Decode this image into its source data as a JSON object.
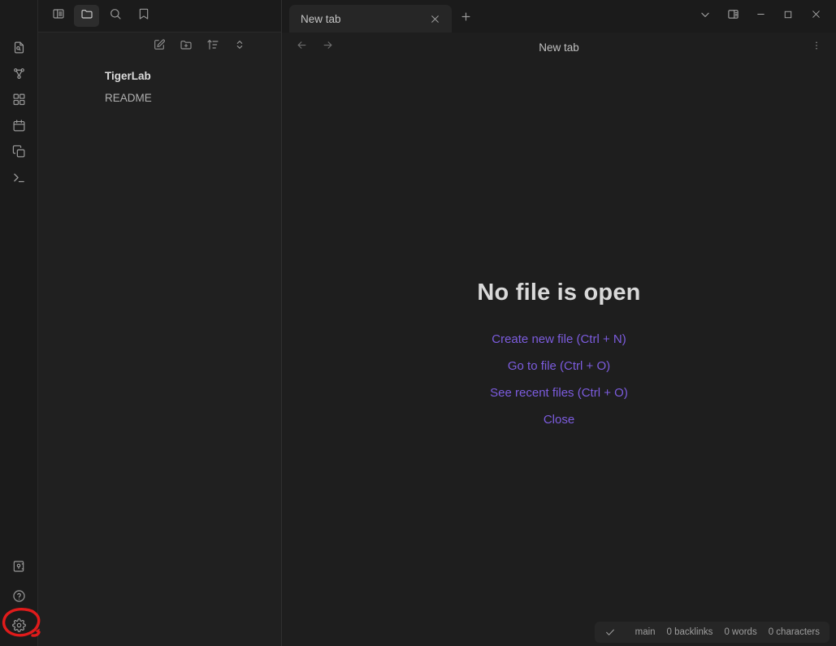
{
  "app": {
    "window_title": "New tab",
    "theme": "dark"
  },
  "colors": {
    "background": "#1e1e1e",
    "ribbon_background": "#1b1b1b",
    "sidebar_background": "#202020",
    "tab_active_background": "#262626",
    "link_accent": "#7c5cde",
    "text_normal": "#c4c4c4",
    "text_muted": "#9a9a9a",
    "annotation_red": "#e01b1b"
  },
  "ribbon": {
    "top_items": [
      {
        "name": "toggle-left-sidebar",
        "icon": "sidebar-toggle-icon",
        "label": "Toggle left sidebar"
      },
      {
        "name": "files",
        "icon": "folder-icon",
        "label": "Files",
        "active": true
      },
      {
        "name": "search",
        "icon": "search-icon",
        "label": "Search"
      },
      {
        "name": "bookmarks",
        "icon": "bookmark-icon",
        "label": "Bookmarks"
      }
    ],
    "items": [
      {
        "name": "quick-switcher",
        "icon": "file-search-icon",
        "label": "Quick switcher"
      },
      {
        "name": "graph-view",
        "icon": "graph-icon",
        "label": "Open graph view"
      },
      {
        "name": "canvas",
        "icon": "grid-icon",
        "label": "Create new canvas"
      },
      {
        "name": "daily-note",
        "icon": "calendar-icon",
        "label": "Open today's daily note"
      },
      {
        "name": "templates",
        "icon": "copy-icon",
        "label": "Insert template"
      },
      {
        "name": "terminal",
        "icon": "terminal-icon",
        "label": "Terminal"
      }
    ],
    "bottom_items": [
      {
        "name": "vault-switcher",
        "icon": "vault-icon",
        "label": "Open another vault"
      },
      {
        "name": "help",
        "icon": "help-icon",
        "label": "Help"
      },
      {
        "name": "settings",
        "icon": "gear-icon",
        "label": "Settings",
        "highlighted": true
      }
    ]
  },
  "sidebar": {
    "toolbar": [
      {
        "name": "new-note",
        "icon": "new-note-icon",
        "label": "New note"
      },
      {
        "name": "new-folder",
        "icon": "new-folder-icon",
        "label": "New folder"
      },
      {
        "name": "sort-order",
        "icon": "sort-icon",
        "label": "Change sort order"
      },
      {
        "name": "collapse-expand",
        "icon": "collapse-expand-icon",
        "label": "Expand all"
      }
    ],
    "tree": [
      {
        "name": "vault-root",
        "label": "TigerLab",
        "type": "folder",
        "bold": true
      },
      {
        "name": "file-readme",
        "label": "README",
        "type": "file",
        "bold": false
      }
    ]
  },
  "tabs": [
    {
      "name": "tab-new-tab",
      "label": "New tab",
      "active": true,
      "close_label": "Close"
    }
  ],
  "tab_actions": {
    "new_tab_label": "New tab",
    "tab_list_label": "List of open tabs"
  },
  "window_controls": [
    {
      "name": "tab-list-chevron",
      "icon": "chevron-down-icon",
      "label": "List of tabs"
    },
    {
      "name": "toggle-right-sidebar",
      "icon": "right-sidebar-icon",
      "label": "Toggle right sidebar"
    },
    {
      "name": "minimize",
      "icon": "minimize-icon",
      "label": "Minimize"
    },
    {
      "name": "maximize",
      "icon": "maximize-icon",
      "label": "Maximize"
    },
    {
      "name": "close",
      "icon": "close-icon",
      "label": "Close"
    }
  ],
  "view_header": {
    "back_label": "Navigate back",
    "forward_label": "Navigate forward",
    "title": "New tab",
    "more_label": "More options"
  },
  "empty_state": {
    "title": "No file is open",
    "actions": [
      {
        "name": "create-new-file",
        "label": "Create new file (Ctrl + N)"
      },
      {
        "name": "go-to-file",
        "label": "Go to file (Ctrl + O)"
      },
      {
        "name": "see-recent-files",
        "label": "See recent files (Ctrl + O)"
      },
      {
        "name": "close-pane",
        "label": "Close"
      }
    ]
  },
  "status_bar": {
    "sync_icon": "check-icon",
    "branch": "main",
    "backlinks": "0 backlinks",
    "words": "0 words",
    "characters": "0 characters"
  },
  "annotation": {
    "shape": "ellipse",
    "color": "#e01b1b",
    "target": "settings-gear-icon"
  }
}
